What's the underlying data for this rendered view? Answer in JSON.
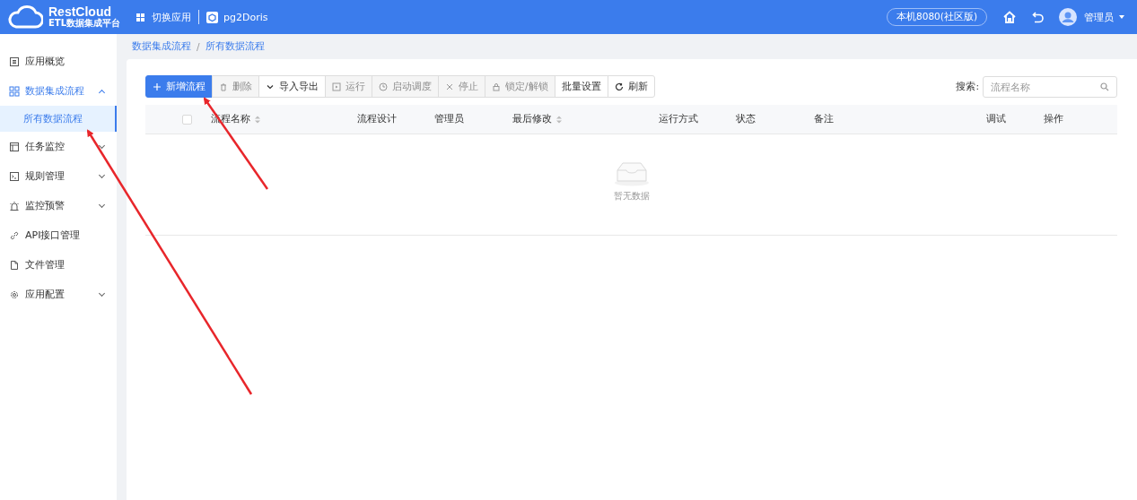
{
  "header": {
    "logo_title": "RestCloud",
    "logo_subtitle": "ETL数据集成平台",
    "switch_app": "切换应用",
    "app_name": "pg2Doris",
    "server": "本机8080(社区版)",
    "user": "管理员"
  },
  "sidebar": {
    "items": [
      {
        "label": "应用概览",
        "selected": false
      },
      {
        "label": "数据集成流程",
        "selected": true,
        "expanded": true,
        "children": [
          {
            "label": "所有数据流程",
            "selected": true
          }
        ]
      },
      {
        "label": "任务监控",
        "selected": false,
        "expanded": false
      },
      {
        "label": "规则管理",
        "selected": false,
        "expanded": false
      },
      {
        "label": "监控预警",
        "selected": false,
        "expanded": false
      },
      {
        "label": "API接口管理",
        "selected": false
      },
      {
        "label": "文件管理",
        "selected": false
      },
      {
        "label": "应用配置",
        "selected": false,
        "expanded": false
      }
    ]
  },
  "breadcrumb": {
    "items": [
      "数据集成流程",
      "所有数据流程"
    ],
    "separator": "/"
  },
  "toolbar": [
    {
      "label": "新增流程",
      "kind": "primary",
      "disabled": false
    },
    {
      "label": "删除",
      "kind": "default",
      "disabled": true
    },
    {
      "label": "导入导出",
      "kind": "default",
      "disabled": false
    },
    {
      "label": "运行",
      "kind": "default",
      "disabled": true
    },
    {
      "label": "启动调度",
      "kind": "default",
      "disabled": true
    },
    {
      "label": "停止",
      "kind": "default",
      "disabled": true
    },
    {
      "label": "锁定/解锁",
      "kind": "default",
      "disabled": true
    },
    {
      "label": "批量设置",
      "kind": "default",
      "disabled": false
    },
    {
      "label": "刷新",
      "kind": "default",
      "disabled": false
    }
  ],
  "search": {
    "label": "搜索:",
    "placeholder": "流程名称"
  },
  "table": {
    "select_all_checked": false,
    "columns": [
      {
        "label": "流程名称",
        "sortable": true
      },
      {
        "label": "流程设计"
      },
      {
        "label": "管理员"
      },
      {
        "label": "最后修改",
        "sortable": true
      },
      {
        "label": "运行方式"
      },
      {
        "label": "状态"
      },
      {
        "label": "备注"
      },
      {
        "label": "调试"
      },
      {
        "label": "操作"
      }
    ],
    "empty_text": "暂无数据"
  }
}
